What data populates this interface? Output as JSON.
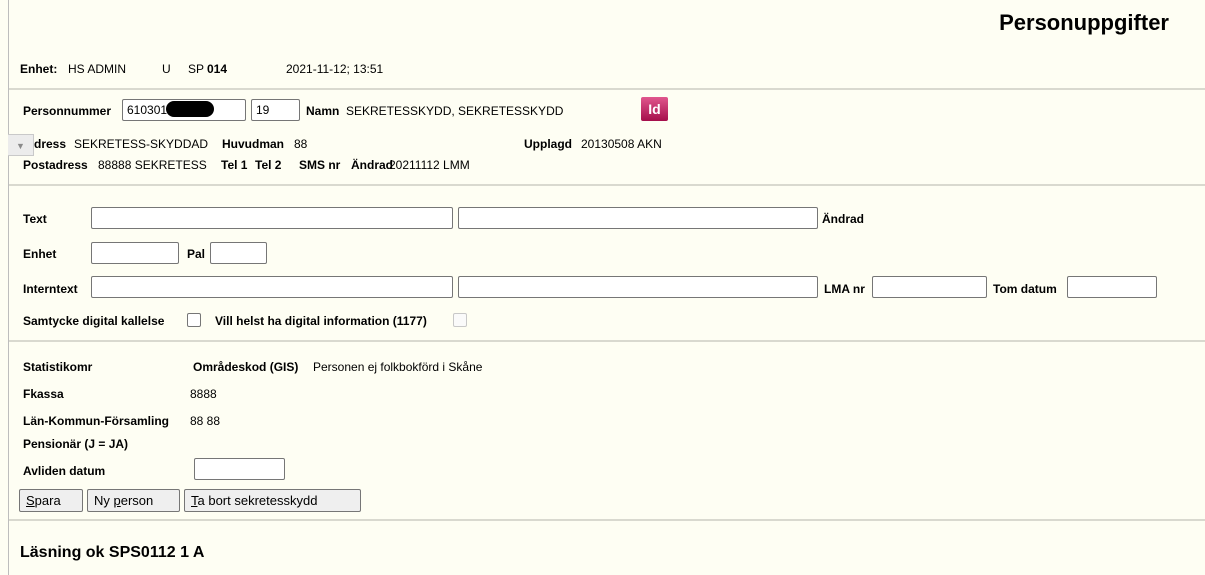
{
  "page_title": "Personuppgifter",
  "header": {
    "enhet_label": "Enhet:",
    "enhet_value": "HS ADMIN",
    "flag": "U",
    "sp_label": "SP",
    "sp_value": "014",
    "datetime": "2021-11-12; 13:51"
  },
  "person": {
    "personnummer_label": "Personnummer",
    "personnummer_value": "610301",
    "century_value": "19",
    "namn_label": "Namn",
    "namn_value": "SEKRETESSKYDD, SEKRETESSKYDD",
    "id_icon_text": "Id",
    "adress_label": "dress",
    "adress_value": "SEKRETESS-SKYDDAD",
    "huvudman_label": "Huvudman",
    "huvudman_value": "88",
    "upplagd_label": "Upplagd",
    "upplagd_value": "20130508 AKN",
    "postadress_label": "Postadress",
    "postadress_value": "88888 SEKRETESS",
    "tel1_label": "Tel 1",
    "tel2_label": "Tel 2",
    "sms_label": "SMS nr",
    "andrad_label": "Ändrad",
    "andrad_value": "20211112 LMM"
  },
  "form": {
    "text_label": "Text",
    "text_andrad_label": "Ändrad",
    "text1_value": "",
    "text2_value": "",
    "enhet_label": "Enhet",
    "enhet_value": "",
    "pal_label": "Pal",
    "pal_value": "",
    "interntext_label": "Interntext",
    "interntext1_value": "",
    "interntext2_value": "",
    "lma_label": "LMA nr",
    "lma_value": "",
    "tom_datum_label": "Tom datum",
    "tom_datum_value": "",
    "samtycke_label": "Samtycke digital kallelse",
    "samtycke_checked": false,
    "digital_info_label": "Vill helst ha digital information (1177)",
    "digital_info_checked": false
  },
  "stats": {
    "statistikomr_label": "Statistikomr",
    "omradeskod_label": "Områdeskod (GIS)",
    "omradeskod_value": "Personen ej folkbokförd i Skåne",
    "fkassa_label": "Fkassa",
    "fkassa_value": "8888",
    "lkf_label": "Län-Kommun-Församling",
    "lkf_value": "88 88",
    "pensionar_label": "Pensionär (J = JA)",
    "avliden_label": "Avliden datum",
    "avliden_value": ""
  },
  "buttons": {
    "spara_u": "S",
    "spara_rest": "para",
    "ny_pre": "Ny ",
    "ny_u": "p",
    "ny_rest": "erson",
    "tabort_u": "T",
    "tabort_rest": "a bort sekretesskydd"
  },
  "status_message": "Läsning ok SPS0112 1 A",
  "icons": {
    "id_icon": "id-badge",
    "side_tab_icon": "chevron-down"
  }
}
